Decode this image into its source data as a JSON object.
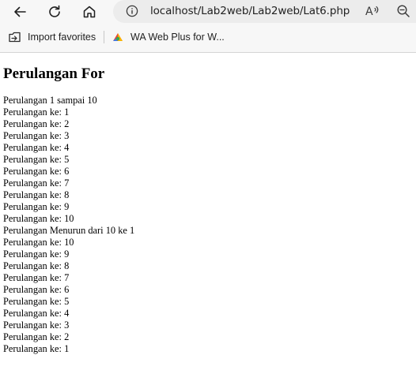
{
  "browser": {
    "url": "localhost/Lab2web/Lab2web/Lat6.php",
    "favorites": [
      {
        "label": "Import favorites",
        "icon": "import-favorites-icon"
      },
      {
        "label": "WA Web Plus for W...",
        "icon": "wa-web-plus-icon"
      }
    ]
  },
  "page": {
    "heading": "Perulangan For",
    "lines": [
      "Perulangan 1 sampai 10",
      "Perulangan ke: 1",
      "Perulangan ke: 2",
      "Perulangan ke: 3",
      "Perulangan ke: 4",
      "Perulangan ke: 5",
      "Perulangan ke: 6",
      "Perulangan ke: 7",
      "Perulangan ke: 8",
      "Perulangan ke: 9",
      "Perulangan ke: 10",
      "Perulangan Menurun dari 10 ke 1",
      "Perulangan ke: 10",
      "Perulangan ke: 9",
      "Perulangan ke: 8",
      "Perulangan ke: 7",
      "Perulangan ke: 6",
      "Perulangan ke: 5",
      "Perulangan ke: 4",
      "Perulangan ke: 3",
      "Perulangan ke: 2",
      "Perulangan ke: 1"
    ]
  }
}
